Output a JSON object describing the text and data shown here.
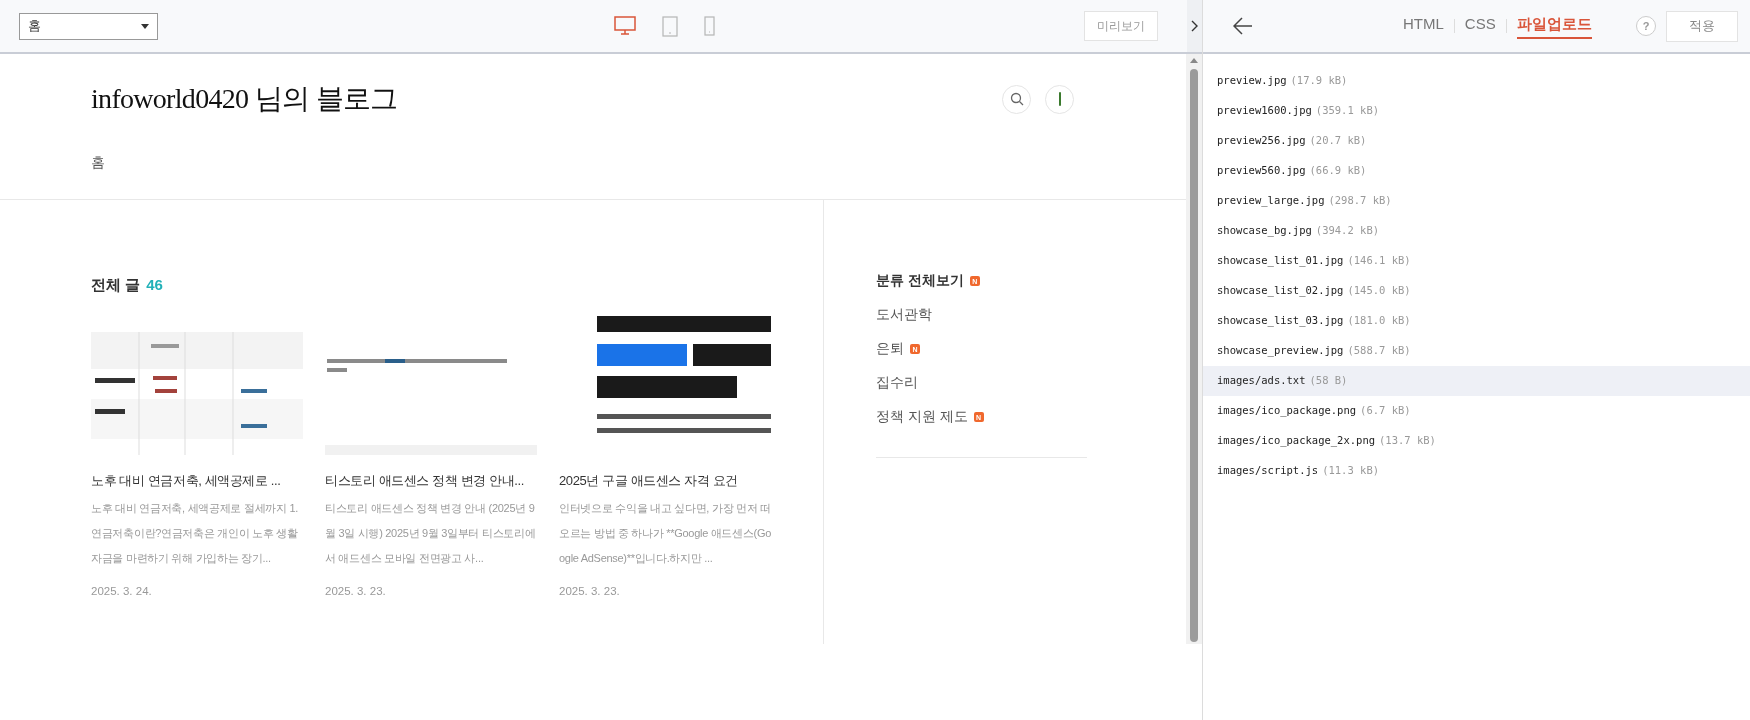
{
  "toolbar": {
    "page_select": "홈",
    "devices": [
      {
        "kind": "desktop",
        "selected": true
      },
      {
        "kind": "tablet",
        "selected": false
      },
      {
        "kind": "mobile",
        "selected": false
      }
    ],
    "preview_button": "미리보기"
  },
  "blog": {
    "title": "infoworld0420 님의 블로그",
    "nav": [
      {
        "label": "홈"
      }
    ],
    "section_label": "전체 글",
    "post_count": "46",
    "posts": [
      {
        "title": "노후 대비 연금저축, 세액공제로 ...",
        "excerpt": "노후 대비 연금저축, 세액공제로 절세까지 1. 연금저축이란?연금저축은 개인이 노후 생활자금을 마련하기 위해 가입하는 장기...",
        "date": "2025. 3. 24."
      },
      {
        "title": "티스토리 애드센스 정책 변경 안내...",
        "excerpt": "티스토리 애드센스 정책 변경 안내 (2025년 9월 3일 시행) 2025년 9월 3일부터 티스토리에서 애드센스 모바일 전면광고 사...",
        "date": "2025. 3. 23."
      },
      {
        "title": "2025년 구글 애드센스 자격 요건",
        "excerpt": "인터넷으로 수익을 내고 싶다면, 가장 먼저 떠오르는 방법 중 하나가 **Google 애드센스(Google AdSense)**입니다.하지만 ...",
        "date": "2025. 3. 23."
      }
    ],
    "categories": [
      {
        "kind": "all",
        "label": "분류 전체보기",
        "badge": "N"
      },
      {
        "kind": "category",
        "label": "도서관학"
      },
      {
        "kind": "category",
        "label": "은퇴",
        "badge": "N"
      },
      {
        "kind": "category",
        "label": "집수리"
      },
      {
        "kind": "category",
        "label": "정책 지원 제도",
        "badge": "N"
      }
    ]
  },
  "editor": {
    "tabs": [
      {
        "label": "HTML",
        "selected": false
      },
      {
        "label": "CSS",
        "selected": false
      },
      {
        "label": "파일업로드",
        "selected": true
      }
    ],
    "help": "?",
    "apply_button": "적용",
    "files": [
      {
        "name": "preview.jpg",
        "size": "(17.9 kB)",
        "selected": false
      },
      {
        "name": "preview1600.jpg",
        "size": "(359.1 kB)",
        "selected": false
      },
      {
        "name": "preview256.jpg",
        "size": "(20.7 kB)",
        "selected": false
      },
      {
        "name": "preview560.jpg",
        "size": "(66.9 kB)",
        "selected": false
      },
      {
        "name": "preview_large.jpg",
        "size": "(298.7 kB)",
        "selected": false
      },
      {
        "name": "showcase_bg.jpg",
        "size": "(394.2 kB)",
        "selected": false
      },
      {
        "name": "showcase_list_01.jpg",
        "size": "(146.1 kB)",
        "selected": false
      },
      {
        "name": "showcase_list_02.jpg",
        "size": "(145.0 kB)",
        "selected": false
      },
      {
        "name": "showcase_list_03.jpg",
        "size": "(181.0 kB)",
        "selected": false
      },
      {
        "name": "showcase_preview.jpg",
        "size": "(588.7 kB)",
        "selected": false
      },
      {
        "name": "images/ads.txt",
        "size": "(58 B)",
        "selected": true
      },
      {
        "name": "images/ico_package.png",
        "size": "(6.7 kB)",
        "selected": false
      },
      {
        "name": "images/ico_package_2x.png",
        "size": "(13.7 kB)",
        "selected": false
      },
      {
        "name": "images/script.js",
        "size": "(11.3 kB)",
        "selected": false
      }
    ]
  }
}
